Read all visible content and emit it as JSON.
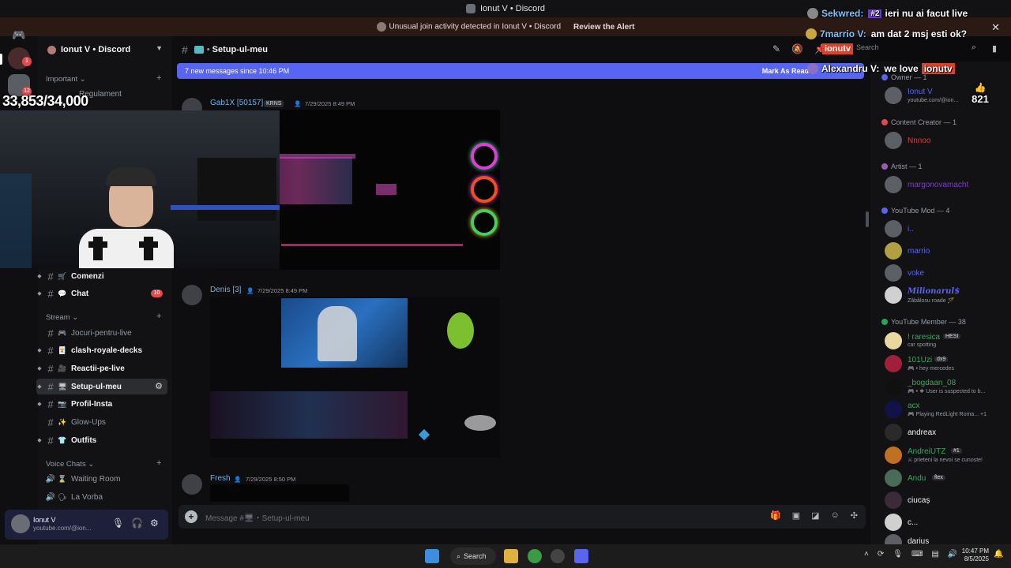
{
  "window_title": "Ionut V • Discord",
  "alert": {
    "text": "Unusual join activity detected in Ionut V • Discord",
    "action": "Review the Alert"
  },
  "server": {
    "name": "Ionut V • Discord",
    "rail_badges": [
      "1",
      "12"
    ]
  },
  "overlay": {
    "viewer_count": "33,853/34,000",
    "likes": "821",
    "chat": [
      {
        "name": "Sekwred:",
        "msg": "ieri nu ai facut live",
        "badge": "#2"
      },
      {
        "name": "7marrio V:",
        "msg": "am dat 2 msj esti ok?"
      },
      {
        "name": "Alexandru V:",
        "msg": "we love",
        "highlight": "ionutv"
      }
    ],
    "brand": "ionutv"
  },
  "sidebar": {
    "categories": {
      "important": "Important",
      "stream": "Stream",
      "voice": "Voice Chats"
    },
    "channels_visible_top": [
      "Regulament"
    ],
    "channels": [
      {
        "label": "Comenzi",
        "emoji": "🛒",
        "unread": true
      },
      {
        "label": "Chat",
        "emoji": "💬",
        "unread": true,
        "badge": "10"
      },
      {
        "label": "Jocuri-pentru-live",
        "emoji": "🎮",
        "unread": false
      },
      {
        "label": "clash-royale-decks",
        "emoji": "🃏",
        "unread": true
      },
      {
        "label": "Reactii-pe-live",
        "emoji": "🎥",
        "unread": true
      },
      {
        "label": "Setup-ul-meu",
        "emoji": "🖥",
        "unread": true,
        "selected": true
      },
      {
        "label": "Profil-Insta",
        "emoji": "📷",
        "unread": true
      },
      {
        "label": "Glow-Ups",
        "emoji": "✨",
        "unread": false
      },
      {
        "label": "Outfits",
        "emoji": "👕",
        "unread": true
      }
    ],
    "voice": [
      {
        "label": "Waiting Room",
        "emoji": "⌛"
      },
      {
        "label": "La Vorba",
        "emoji": "🗣"
      }
    ]
  },
  "user_panel": {
    "name": "Ionut V",
    "status": "youtube.com/@ion..."
  },
  "channel": {
    "name": "Setup-ul-meu",
    "new_messages": "7 new messages since 10:46 PM",
    "mark_read": "Mark As Read",
    "search_placeholder": "Search",
    "composer_placeholder": "Message #🖥・Setup-ul-meu"
  },
  "messages": [
    {
      "author": "Gab1X [50157]",
      "tag": "KRNS",
      "time": "7/29/2025 8:49 PM"
    },
    {
      "author": "Denis [3]",
      "time": "7/29/2025 8:49 PM"
    },
    {
      "author": "Fresh",
      "time": "7/29/2025 8:50 PM"
    }
  ],
  "members": {
    "roles": [
      {
        "label": "Owner — 1",
        "color": "#5865f2"
      },
      {
        "label": "Content Creator — 1",
        "color": "#e5484d"
      },
      {
        "label": "Artist — 1",
        "color": "#9b59b6"
      },
      {
        "label": "YouTube Mod — 4",
        "color": "#5865f2"
      },
      {
        "label": "YouTube Member — 38",
        "color": "#23a55a"
      }
    ],
    "owner": [
      {
        "name": "Ionut V",
        "sub": "youtube.com/@ion...",
        "color": "#5865f2"
      }
    ],
    "creator": [
      {
        "name": "Nnnoo",
        "color": "#d83c3e"
      }
    ],
    "artist": [
      {
        "name": "margonovamacht",
        "color": "#7d3fc4"
      }
    ],
    "mods": [
      {
        "name": "i..",
        "color": "#5865f2"
      },
      {
        "name": "marrio",
        "color": "#5865f2"
      },
      {
        "name": "voke",
        "color": "#5865f2"
      },
      {
        "name": "Milionarul$",
        "sub": "Zăbălosu roade 🪄",
        "color": "#5865f2"
      }
    ],
    "yt_members": [
      {
        "name": "! raresica",
        "tag": "HESI",
        "sub": "car spotting",
        "color": "#3ba55d"
      },
      {
        "name": "101Uzi",
        "tag": "dx9",
        "sub": "🎮 • hey mercedes",
        "color": "#3ba55d"
      },
      {
        "name": "_bogdaan_08",
        "sub": "🎮 • ❖ User is suspected to b...",
        "color": "#3ba55d"
      },
      {
        "name": "acx",
        "sub": "🎮 Playing RedLight Roma... +1",
        "color": "#3ba55d"
      },
      {
        "name": "andreax",
        "color": "#f2f3f5"
      },
      {
        "name": "AndreiUTZ",
        "tag": "#1",
        "sub": "⚔ prieteni la nevoi se cunoste!",
        "color": "#3ba55d"
      },
      {
        "name": "Andu",
        "tag": "flex",
        "color": "#3ba55d"
      },
      {
        "name": "ciucaș",
        "color": "#f2f3f5"
      },
      {
        "name": "c...",
        "color": "#f2f3f5"
      },
      {
        "name": "darius",
        "color": "#f2f3f5"
      }
    ]
  },
  "taskbar": {
    "search_label": "Search",
    "time": "10:47 PM",
    "date": "8/5/2025"
  }
}
